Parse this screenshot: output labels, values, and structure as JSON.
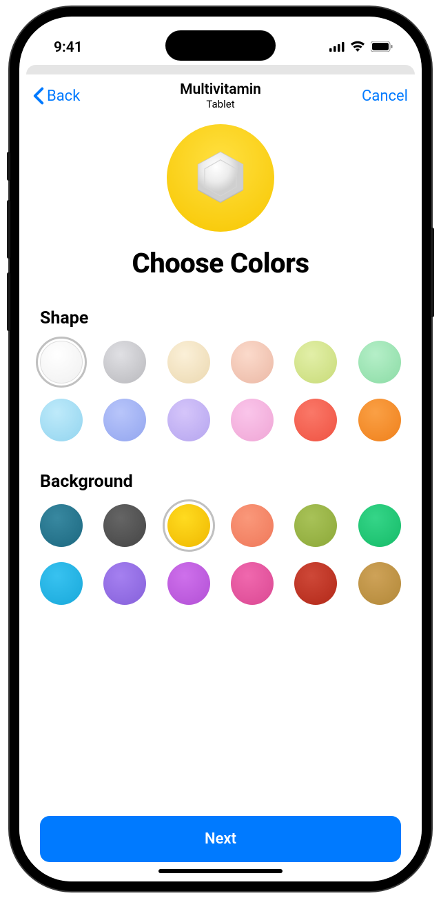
{
  "status": {
    "time": "9:41"
  },
  "nav": {
    "back_label": "Back",
    "title": "Multivitamin",
    "subtitle": "Tablet",
    "cancel_label": "Cancel"
  },
  "page": {
    "title": "Choose Colors"
  },
  "shape_section": {
    "label": "Shape",
    "colors": [
      {
        "name": "white",
        "hex": "#FFFFFF",
        "gradient": "#FFFFFF,#F0F0F0",
        "selected": true
      },
      {
        "name": "gray",
        "hex": "#C8C8CC",
        "gradient": "#E0E0E4,#B8B8BC",
        "selected": false
      },
      {
        "name": "cream",
        "hex": "#F5E5C5",
        "gradient": "#FBF0D8,#EBD8B0",
        "selected": false
      },
      {
        "name": "peach",
        "hex": "#F5C8B8",
        "gradient": "#FBDACB,#EBB8A5",
        "selected": false
      },
      {
        "name": "lime",
        "hex": "#D5E590",
        "gradient": "#E2EFA8,#C8DB78",
        "selected": false
      },
      {
        "name": "mint",
        "hex": "#A0E5B8",
        "gradient": "#B5EFC8,#8BDBA5",
        "selected": false
      },
      {
        "name": "sky",
        "hex": "#A8DFF5",
        "gradient": "#BEEAFA,#92D4EF",
        "selected": false
      },
      {
        "name": "periwinkle",
        "hex": "#A5B5F5",
        "gradient": "#B8C5FA,#92A5EF",
        "selected": false
      },
      {
        "name": "lavender",
        "hex": "#C5B5F5",
        "gradient": "#D5C5FA,#B5A5EF",
        "selected": false
      },
      {
        "name": "pink",
        "hex": "#F5B5E0",
        "gradient": "#FAC5EA,#EFA5D5",
        "selected": false
      },
      {
        "name": "red",
        "hex": "#F56555",
        "gradient": "#FA7868,#EF5242",
        "selected": false
      },
      {
        "name": "orange",
        "hex": "#F59030",
        "gradient": "#FAA045,#EF801B",
        "selected": false
      }
    ]
  },
  "background_section": {
    "label": "Background",
    "colors": [
      {
        "name": "teal",
        "hex": "#2A7890",
        "gradient": "#3888A0,#1C6880",
        "selected": false
      },
      {
        "name": "charcoal",
        "hex": "#555555",
        "gradient": "#656565,#454545",
        "selected": false
      },
      {
        "name": "yellow",
        "hex": "#F7C600",
        "gradient": "#FFDB20,#EFB800",
        "selected": true
      },
      {
        "name": "coral",
        "hex": "#F5886A",
        "gradient": "#FA987A,#EF785A",
        "selected": false
      },
      {
        "name": "olive",
        "hex": "#9AB548",
        "gradient": "#A8C258,#8CA838",
        "selected": false
      },
      {
        "name": "green",
        "hex": "#25C878",
        "gradient": "#35D588,#15BB68",
        "selected": false
      },
      {
        "name": "blue",
        "hex": "#28B5E5",
        "gradient": "#38C2F0,#18A8DA",
        "selected": false
      },
      {
        "name": "purple",
        "hex": "#9570E5",
        "gradient": "#A580F0,#8560DA",
        "selected": false
      },
      {
        "name": "violet",
        "hex": "#C060E0",
        "gradient": "#CE70EB,#B250D5",
        "selected": false
      },
      {
        "name": "magenta",
        "hex": "#E558A0",
        "gradient": "#F068AE,#DA4892",
        "selected": false
      },
      {
        "name": "darkred",
        "hex": "#C03828",
        "gradient": "#CE4838,#B22818",
        "selected": false
      },
      {
        "name": "tan",
        "hex": "#C09548",
        "gradient": "#CEA258,#B28838",
        "selected": false
      }
    ]
  },
  "footer": {
    "next_label": "Next"
  },
  "preview": {
    "shape_color": "#F0F0F0",
    "bg_color": "#F7C600"
  }
}
